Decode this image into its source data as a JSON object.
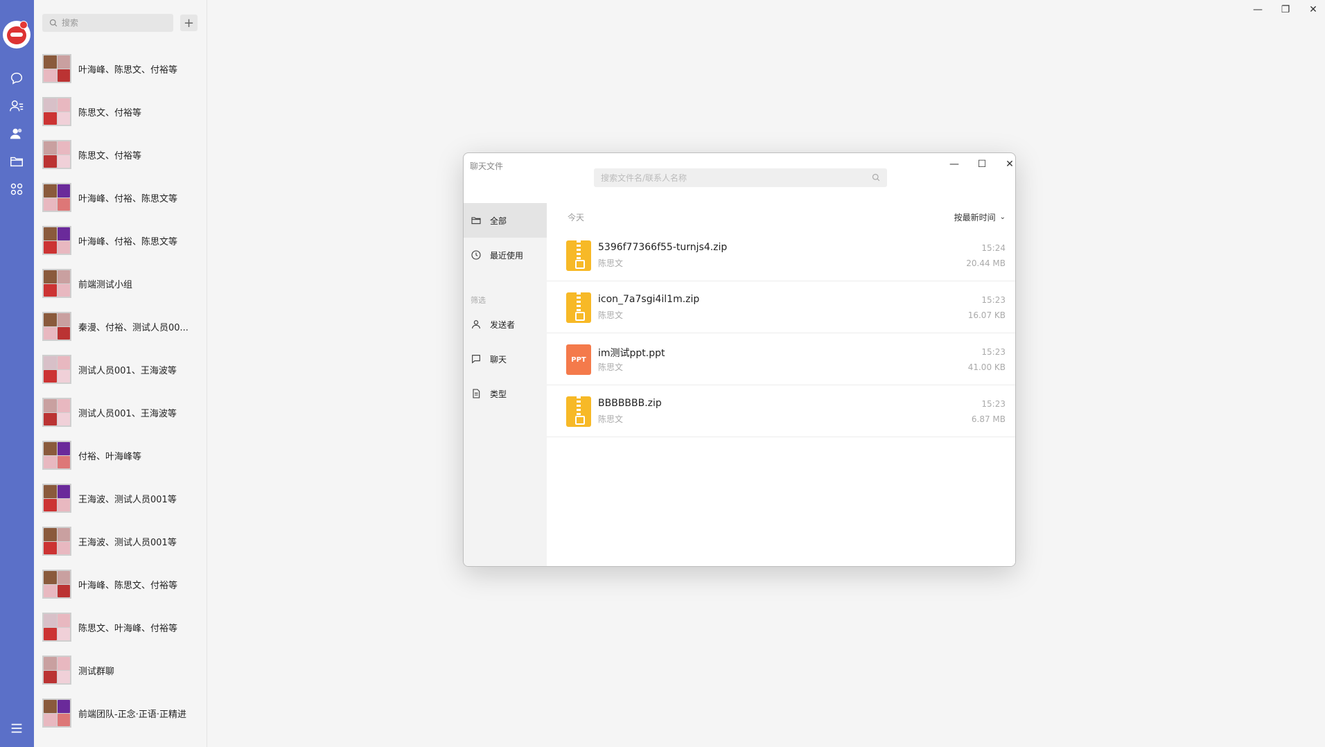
{
  "app": {
    "search_placeholder": "搜索",
    "add_label": "+",
    "window_controls": {
      "minimize": "—",
      "restore": "❐",
      "close": "✕"
    }
  },
  "rail": {
    "icons": [
      "chat-icon",
      "contacts-icon",
      "groups-icon",
      "folder-icon",
      "apps-icon",
      "menu-icon"
    ],
    "accent": "#5b70c8"
  },
  "conversations": [
    {
      "name": "叶海峰、陈思文、付裕等"
    },
    {
      "name": "陈思文、付裕等"
    },
    {
      "name": "陈思文、付裕等"
    },
    {
      "name": "叶海峰、付裕、陈思文等"
    },
    {
      "name": "叶海峰、付裕、陈思文等"
    },
    {
      "name": "前端测试小组"
    },
    {
      "name": "秦漫、付裕、测试人员00..."
    },
    {
      "name": "测试人员001、王海波等"
    },
    {
      "name": "测试人员001、王海波等"
    },
    {
      "name": "付裕、叶海峰等"
    },
    {
      "name": "王海波、测试人员001等"
    },
    {
      "name": "王海波、测试人员001等"
    },
    {
      "name": "叶海峰、陈思文、付裕等"
    },
    {
      "name": "陈思文、叶海峰、付裕等"
    },
    {
      "name": "测试群聊"
    },
    {
      "name": "前端团队-正念·正语·正精进"
    }
  ],
  "dialog": {
    "title": "聊天文件",
    "search_placeholder": "搜索文件名/联系人名称",
    "controls": {
      "minimize": "—",
      "maximize": "☐",
      "close": "✕"
    },
    "sidebar": {
      "all": "全部",
      "recent": "最近使用",
      "filter_section": "筛选",
      "sender": "发送者",
      "chat": "聊天",
      "type": "类型"
    },
    "group_label": "今天",
    "sort_label": "按最新时间",
    "files": [
      {
        "name": "5396f77366f55-turnjs4.zip",
        "sender": "陈思文",
        "time": "15:24",
        "size": "20.44 MB",
        "kind": "zip"
      },
      {
        "name": "icon_7a7sgi4il1m.zip",
        "sender": "陈思文",
        "time": "15:23",
        "size": "16.07 KB",
        "kind": "zip"
      },
      {
        "name": "im测试ppt.ppt",
        "sender": "陈思文",
        "time": "15:23",
        "size": "41.00 KB",
        "kind": "ppt",
        "badge": "PPT"
      },
      {
        "name": "BBBBBBB.zip",
        "sender": "陈思文",
        "time": "15:23",
        "size": "6.87 MB",
        "kind": "zip"
      }
    ]
  }
}
